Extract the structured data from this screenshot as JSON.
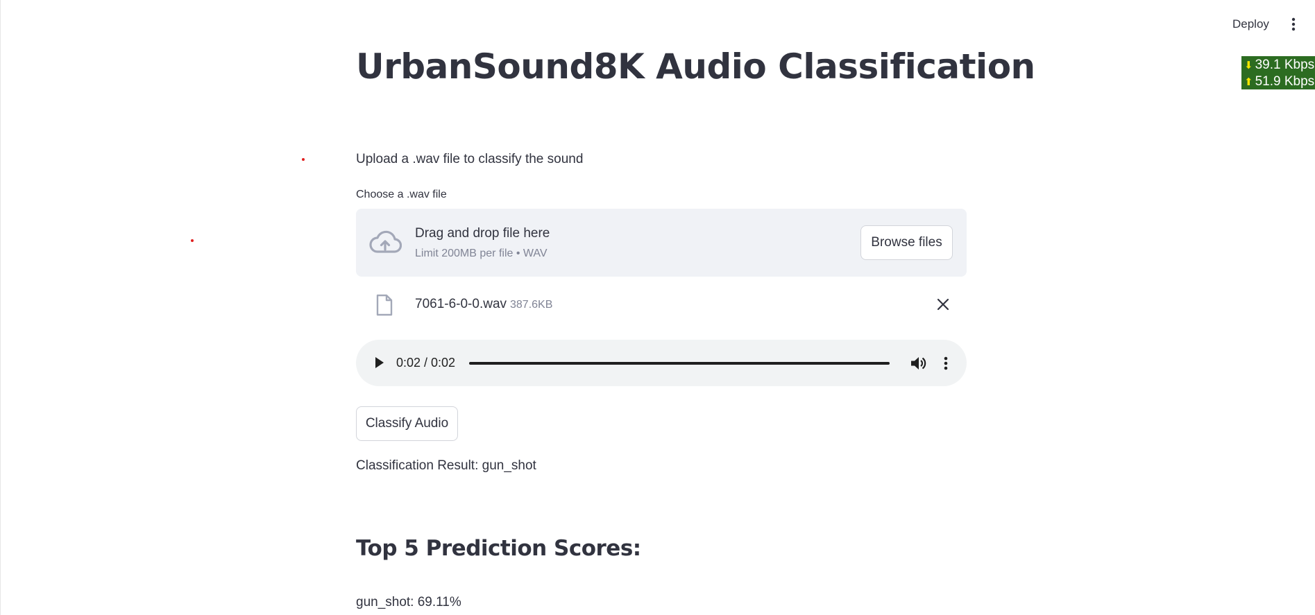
{
  "header": {
    "deploy_label": "Deploy"
  },
  "netspeed": {
    "down": "39.1 Kbps",
    "up": "51.9 Kbps"
  },
  "main": {
    "title": "UrbanSound8K Audio Classification",
    "intro": "Upload a .wav file to classify the sound",
    "uploader": {
      "label": "Choose a .wav file",
      "drop_title": "Drag and drop file here",
      "drop_subtitle": "Limit 200MB per file • WAV",
      "browse_label": "Browse files"
    },
    "file": {
      "name": "7061-6-0-0.wav",
      "size": "387.6KB"
    },
    "player": {
      "time": "0:02 / 0:02",
      "progress": 1.0
    },
    "classify_label": "Classify Audio",
    "result": "Classification Result: gun_shot",
    "top5_heading": "Top 5 Prediction Scores:",
    "scores": [
      "gun_shot: 69.11%"
    ]
  },
  "colors": {
    "text": "#31333f",
    "muted": "#808495",
    "dropzone_bg": "#f0f2f6",
    "player_bg": "#f1f3f4",
    "netspeed_bg": "#2c6c21",
    "netspeed_arrow": "#f3e600",
    "dot": "#e02020"
  }
}
